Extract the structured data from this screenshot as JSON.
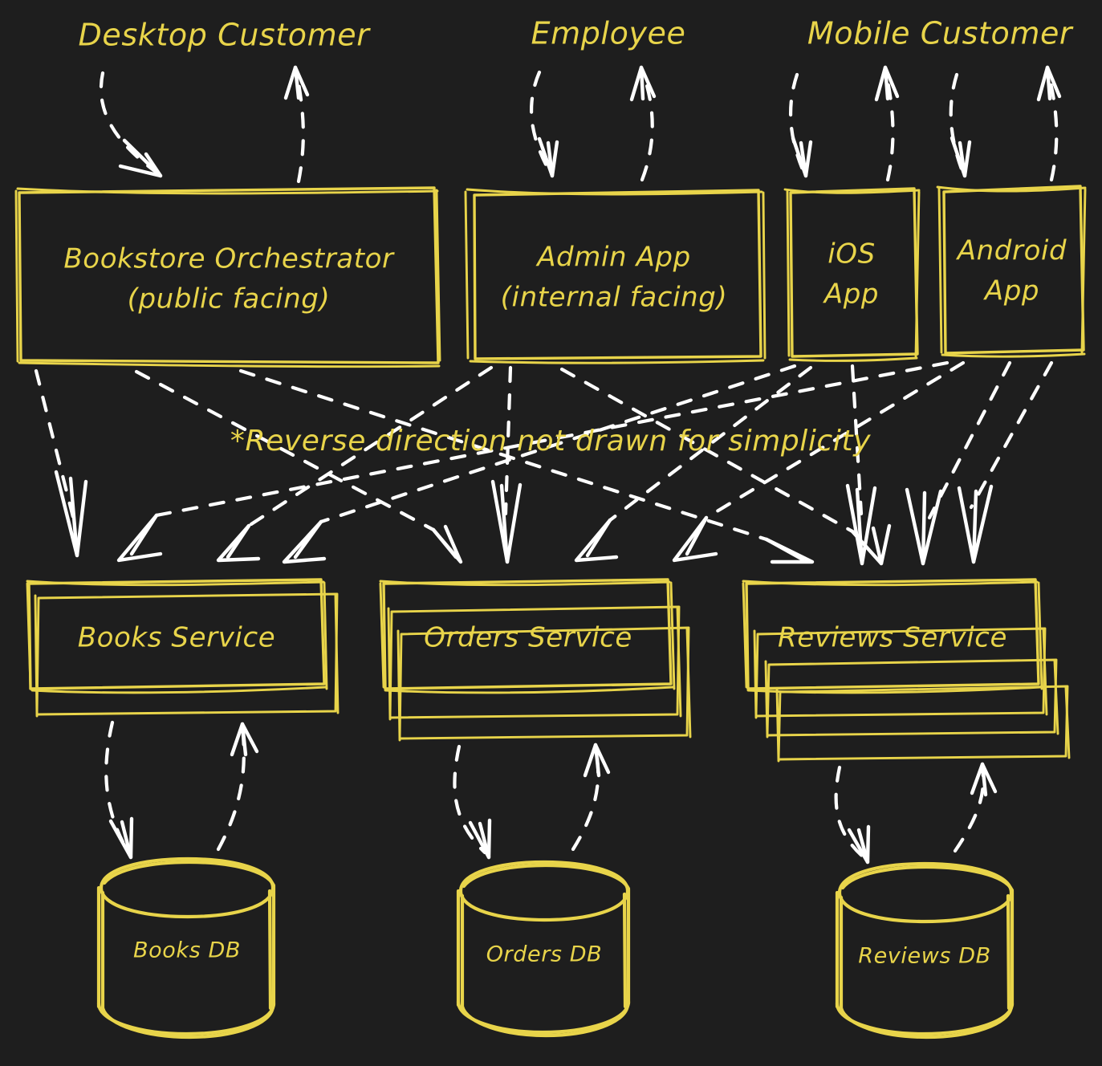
{
  "meta": {
    "title": "Bookstore Microservices Architecture",
    "background_color": "#1e1e1e",
    "sketch_color": "#e8d44a",
    "arrow_color": "#ffffff",
    "style": "hand-drawn excalidraw dark"
  },
  "actors": [
    {
      "id": "desktop-customer",
      "label": "Desktop Customer"
    },
    {
      "id": "employee",
      "label": "Employee"
    },
    {
      "id": "mobile-customer",
      "label": "Mobile Customer"
    }
  ],
  "clients": [
    {
      "id": "bookstore-orchestrator",
      "line1": "Bookstore Orchestrator",
      "line2": "(public facing)"
    },
    {
      "id": "admin-app",
      "line1": "Admin App",
      "line2": "(internal facing)"
    },
    {
      "id": "ios-app",
      "line1": "iOS",
      "line2": "App"
    },
    {
      "id": "android-app",
      "line1": "Android",
      "line2": "App"
    }
  ],
  "note": {
    "text": "*Reverse direction not drawn for simplicity"
  },
  "services": [
    {
      "id": "books-service",
      "label": "Books Service",
      "instances": 2
    },
    {
      "id": "orders-service",
      "label": "Orders Service",
      "instances": 3
    },
    {
      "id": "reviews-service",
      "label": "Reviews Service",
      "instances": 4
    }
  ],
  "databases": [
    {
      "id": "books-db",
      "label": "Books DB"
    },
    {
      "id": "orders-db",
      "label": "Orders DB"
    },
    {
      "id": "reviews-db",
      "label": "Reviews DB"
    }
  ],
  "connections": [
    {
      "from": "desktop-customer",
      "to": "bookstore-orchestrator",
      "bidirectional": true
    },
    {
      "from": "employee",
      "to": "admin-app",
      "bidirectional": true
    },
    {
      "from": "mobile-customer",
      "to": "ios-app",
      "bidirectional": true
    },
    {
      "from": "mobile-customer",
      "to": "android-app",
      "bidirectional": true
    },
    {
      "from": "bookstore-orchestrator",
      "to": "books-service"
    },
    {
      "from": "bookstore-orchestrator",
      "to": "orders-service"
    },
    {
      "from": "bookstore-orchestrator",
      "to": "reviews-service"
    },
    {
      "from": "admin-app",
      "to": "books-service"
    },
    {
      "from": "admin-app",
      "to": "orders-service"
    },
    {
      "from": "admin-app",
      "to": "reviews-service"
    },
    {
      "from": "ios-app",
      "to": "books-service"
    },
    {
      "from": "ios-app",
      "to": "orders-service"
    },
    {
      "from": "ios-app",
      "to": "reviews-service"
    },
    {
      "from": "android-app",
      "to": "books-service"
    },
    {
      "from": "android-app",
      "to": "orders-service"
    },
    {
      "from": "android-app",
      "to": "reviews-service"
    },
    {
      "from": "books-service",
      "to": "books-db",
      "bidirectional": true
    },
    {
      "from": "orders-service",
      "to": "orders-db",
      "bidirectional": true
    },
    {
      "from": "reviews-service",
      "to": "reviews-db",
      "bidirectional": true
    }
  ]
}
